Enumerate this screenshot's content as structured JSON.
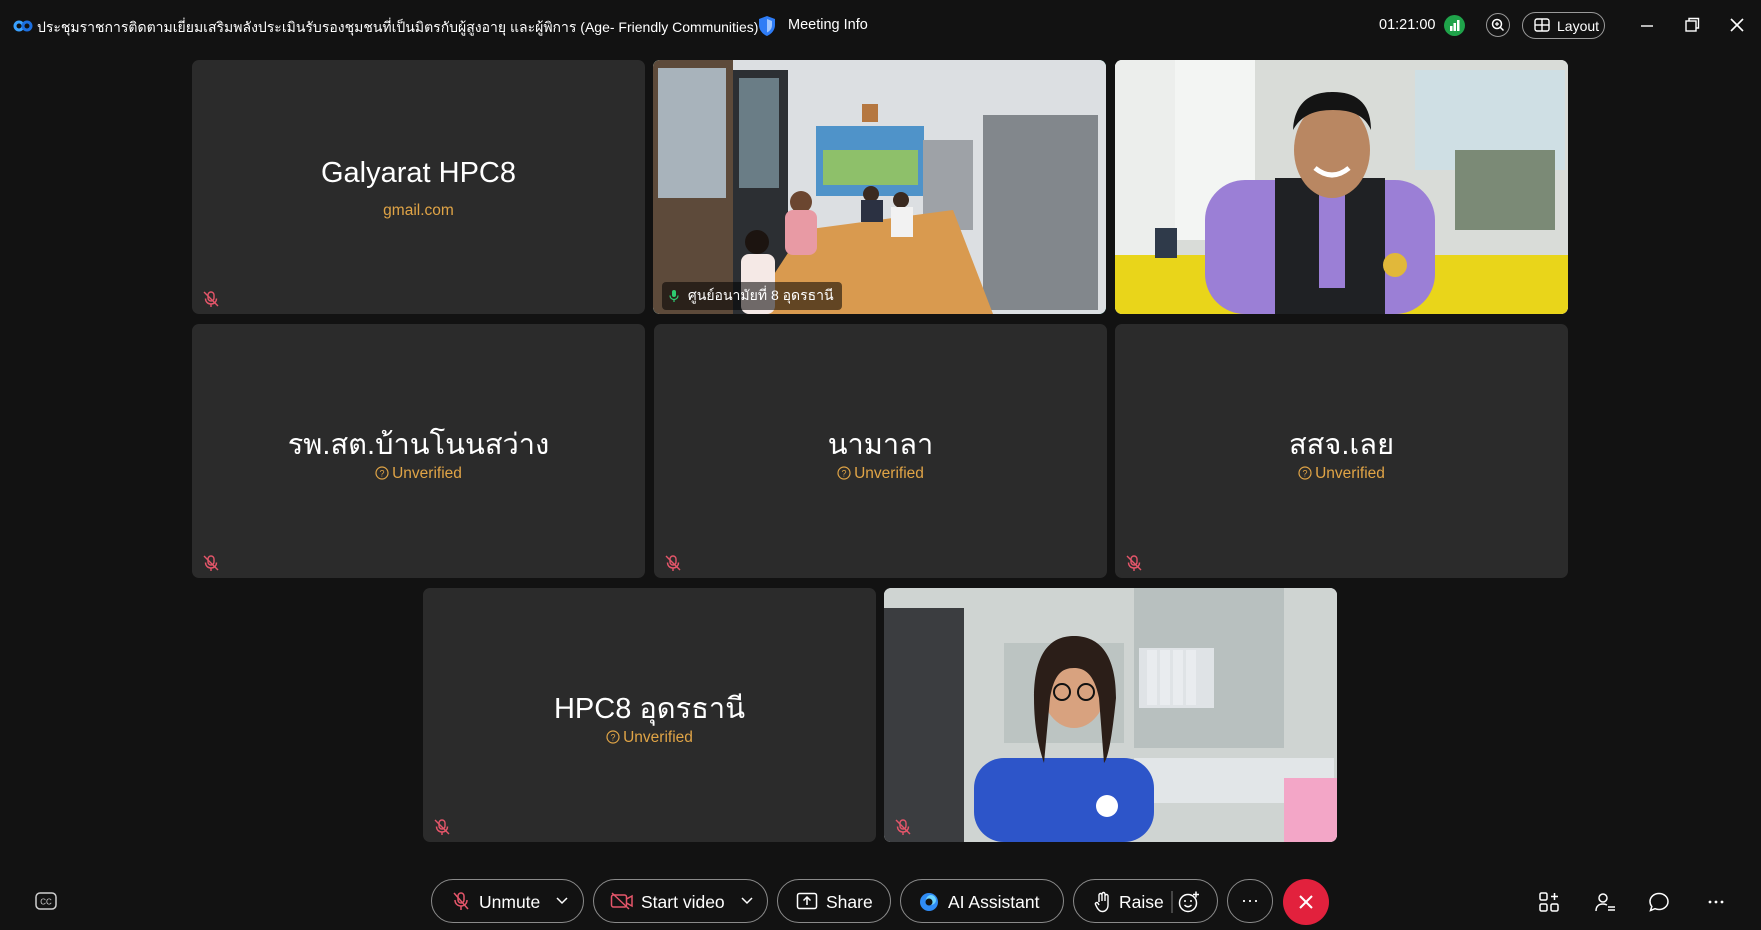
{
  "titlebar": {
    "meeting_title": "ประชุมราชการติดตามเยี่ยมเสริมพลังประเมินรับรองชุมชนที่เป็นมิตรกับผู้สูงอายุ  และผู้พิการ (Age- Friendly Communities)",
    "meeting_info": "Meeting Info",
    "timer": "01:21:00",
    "layout_label": "Layout"
  },
  "tiles": [
    {
      "name": "Galyarat HPC8",
      "sub": "gmail.com",
      "muted": true,
      "video": false
    },
    {
      "name": "ศูนย์อนามัยที่ 8 อุดรธานี",
      "muted": false,
      "video": true,
      "active": true
    },
    {
      "name": "",
      "muted": false,
      "video": true
    },
    {
      "name": "รพ.สต.บ้านโนนสว่าง",
      "sub": "Unverified",
      "muted": true,
      "video": false
    },
    {
      "name": "นามาลา",
      "sub": "Unverified",
      "muted": true,
      "video": false
    },
    {
      "name": "สสจ.เลย",
      "sub": "Unverified",
      "muted": true,
      "video": false
    },
    {
      "name": "HPC8 อุดรธานี",
      "sub": "Unverified",
      "muted": true,
      "video": false
    },
    {
      "name": "",
      "muted": true,
      "video": true
    }
  ],
  "toolbar": {
    "unmute": "Unmute",
    "start_video": "Start video",
    "share": "Share",
    "ai_assistant": "AI Assistant",
    "raise": "Raise",
    "more": "···"
  },
  "colors": {
    "background": "#121212",
    "tile": "#2b2b2b",
    "unverified": "#e0a446",
    "active_border": "#22b5a1",
    "leave": "#e2213d",
    "signal": "#1fa34a"
  },
  "icons": [
    "webex-icon",
    "shield-icon",
    "signal-icon",
    "zoom-icon",
    "layout-icon",
    "minimize-icon",
    "restore-icon",
    "close-icon",
    "mute-icon",
    "mic-icon",
    "camera-off-icon",
    "share-icon",
    "ai-icon",
    "hand-icon",
    "reaction-icon",
    "leave-icon",
    "apps-icon",
    "participants-icon",
    "chat-icon",
    "cc-icon"
  ]
}
